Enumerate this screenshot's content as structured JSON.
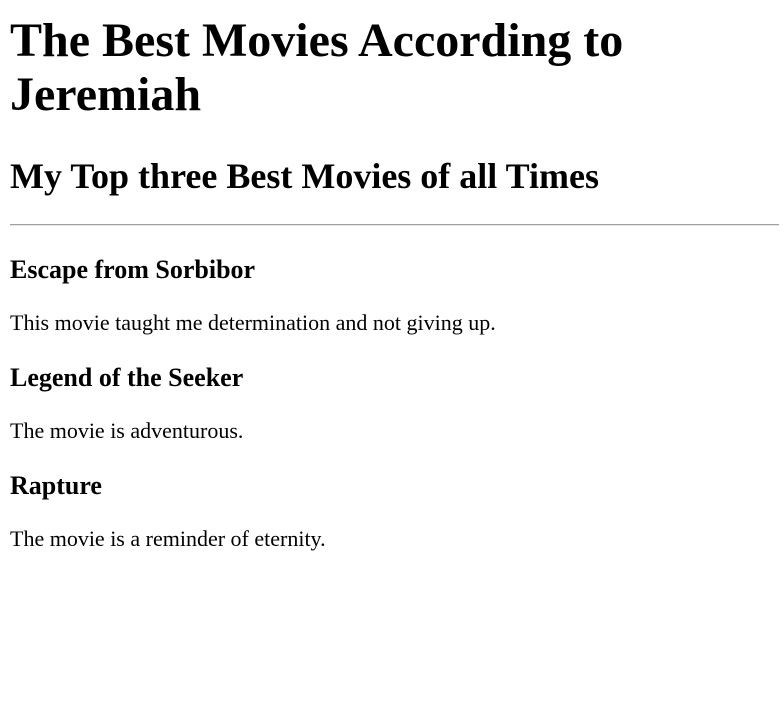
{
  "header": {
    "title": "The Best Movies According to Jeremiah",
    "subtitle": "My Top three Best Movies of all Times"
  },
  "movies": [
    {
      "title": "Escape from Sorbibor",
      "description": "This movie taught me determination and not giving up."
    },
    {
      "title": "Legend of the Seeker",
      "description": "The movie is adventurous."
    },
    {
      "title": "Rapture",
      "description": "The movie is a reminder of eternity."
    }
  ]
}
